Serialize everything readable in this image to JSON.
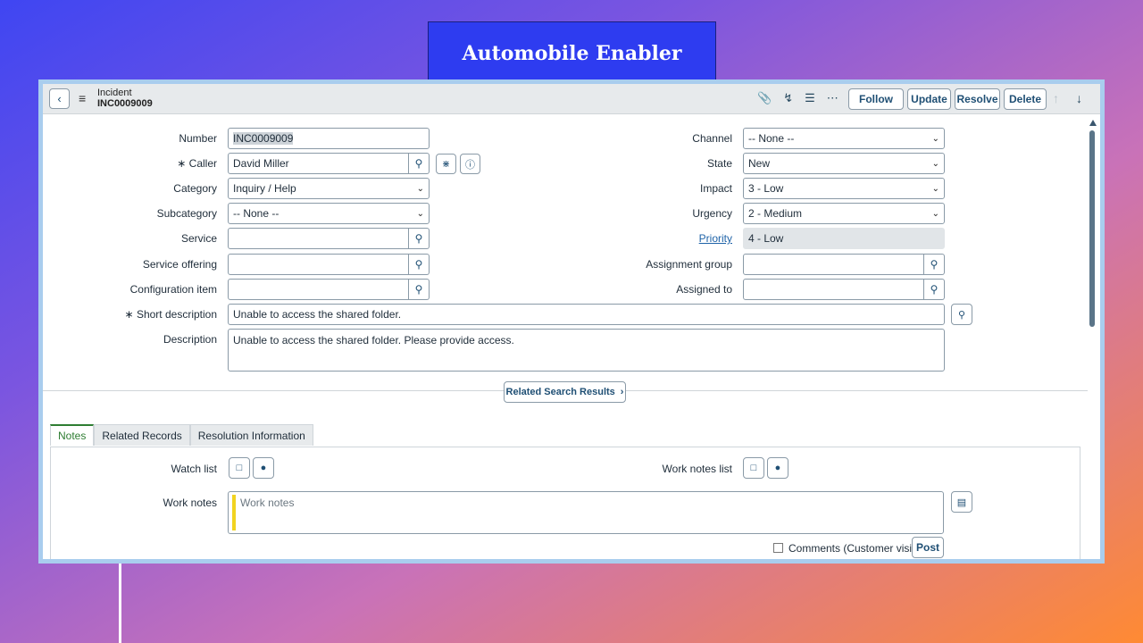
{
  "banner": {
    "title": "Automobile Enabler"
  },
  "header": {
    "record_type": "Incident",
    "record_number": "INC0009009",
    "buttons": {
      "follow": "Follow",
      "update": "Update",
      "resolve": "Resolve",
      "delete": "Delete"
    }
  },
  "icons": {
    "back": "chevron-left-icon",
    "menu": "hamburger-icon",
    "attach": "paperclip-icon",
    "activity": "pulse-icon",
    "settings": "sliders-icon",
    "more": "ellipsis-icon",
    "up": "arrow-up-icon",
    "down": "arrow-down-icon",
    "search": "magnifier-icon"
  },
  "form": {
    "number": {
      "label": "Number",
      "value": "INC0009009"
    },
    "caller": {
      "label": "Caller",
      "value": "David Miller",
      "required_mark": "∗"
    },
    "category": {
      "label": "Category",
      "value": "Inquiry / Help"
    },
    "subcategory": {
      "label": "Subcategory",
      "value": "-- None --"
    },
    "service": {
      "label": "Service",
      "value": ""
    },
    "service_offering": {
      "label": "Service offering",
      "value": ""
    },
    "configuration_item": {
      "label": "Configuration item",
      "value": ""
    },
    "short_description": {
      "label": "Short description",
      "value": "Unable to access the shared folder.",
      "required_mark": "∗"
    },
    "description": {
      "label": "Description",
      "value": "Unable to access the shared folder. Please provide access."
    },
    "channel": {
      "label": "Channel",
      "value": "-- None --"
    },
    "state": {
      "label": "State",
      "value": "New"
    },
    "impact": {
      "label": "Impact",
      "value": "3 - Low"
    },
    "urgency": {
      "label": "Urgency",
      "value": "2 - Medium"
    },
    "priority": {
      "label": "Priority",
      "value": "4 - Low"
    },
    "assignment_group": {
      "label": "Assignment group",
      "value": ""
    },
    "assigned_to": {
      "label": "Assigned to",
      "value": ""
    }
  },
  "related_search": {
    "label": "Related Search Results"
  },
  "tabs": [
    {
      "label": "Notes",
      "active": true
    },
    {
      "label": "Related Records",
      "active": false
    },
    {
      "label": "Resolution Information",
      "active": false
    }
  ],
  "notes": {
    "watch_list": "Watch list",
    "work_notes_list": "Work notes list",
    "work_notes_label": "Work notes",
    "work_notes_placeholder": "Work notes",
    "comments_checkbox": "Comments (Customer visible)",
    "post": "Post"
  },
  "colors": {
    "accent": "#1f4f74",
    "active_tab": "#2e7d32",
    "frame": "#a9cdee",
    "banner": "#2e3cf0"
  }
}
